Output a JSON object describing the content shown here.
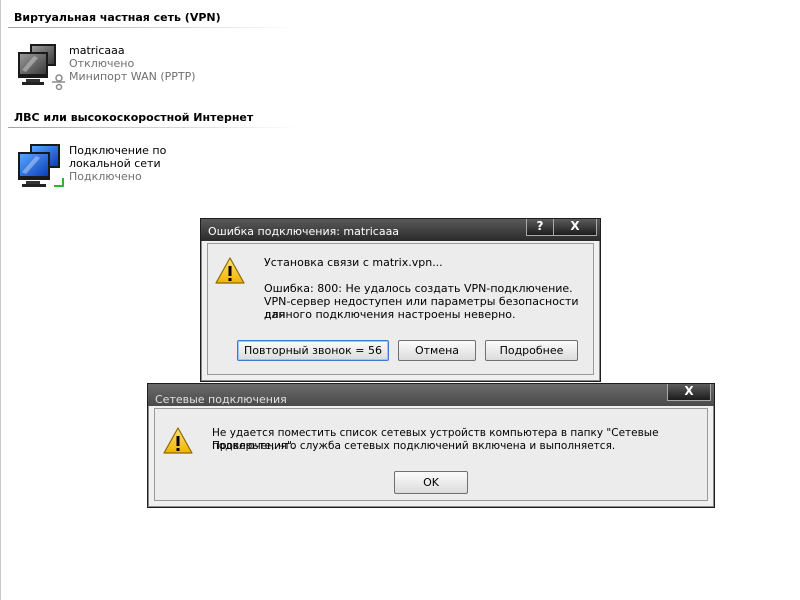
{
  "groups": {
    "vpn_header": "Виртуальная частная сеть (VPN)",
    "lan_header": "ЛВС или высокоскоростной Интернет"
  },
  "connections": {
    "vpn": {
      "name": "matricaaa",
      "status": "Отключено",
      "device": "Минипорт WAN (PPTP)",
      "icon": "vpn-connection-icon"
    },
    "lan": {
      "name": "Подключение по локальной сети",
      "status": "Подключено",
      "icon": "lan-connection-icon"
    }
  },
  "error_dialog": {
    "title": "Ошибка подключения: matricaaa",
    "help_label": "?",
    "close_label": "X",
    "connecting_text": "Установка связи с matrix.vpn...",
    "error_line1": "Ошибка: 800: Не удалось создать VPN-подключение.",
    "error_line2": "VPN-сервер недоступен или параметры безопасности для",
    "error_line3": "данного подключения настроены неверно.",
    "redial_label": "Повторный звонок = 56",
    "cancel_label": "Отмена",
    "more_label": "Подробнее",
    "icon": "warning-icon"
  },
  "netconn_dialog": {
    "title": "Сетевые подключения",
    "close_label": "X",
    "line1": "Не удается поместить список сетевых устройств компьютера в папку \"Сетевые подключения\".",
    "line2": "Проверьте, что служба сетевых подключений включена и выполняется.",
    "ok_label": "OK",
    "icon": "warning-icon"
  },
  "colors": {
    "title_bar": "#2a2a2a",
    "dialog_bg": "#f0f0f0",
    "subtext": "#6f6f6f",
    "warning_yellow": "#f5c400"
  }
}
